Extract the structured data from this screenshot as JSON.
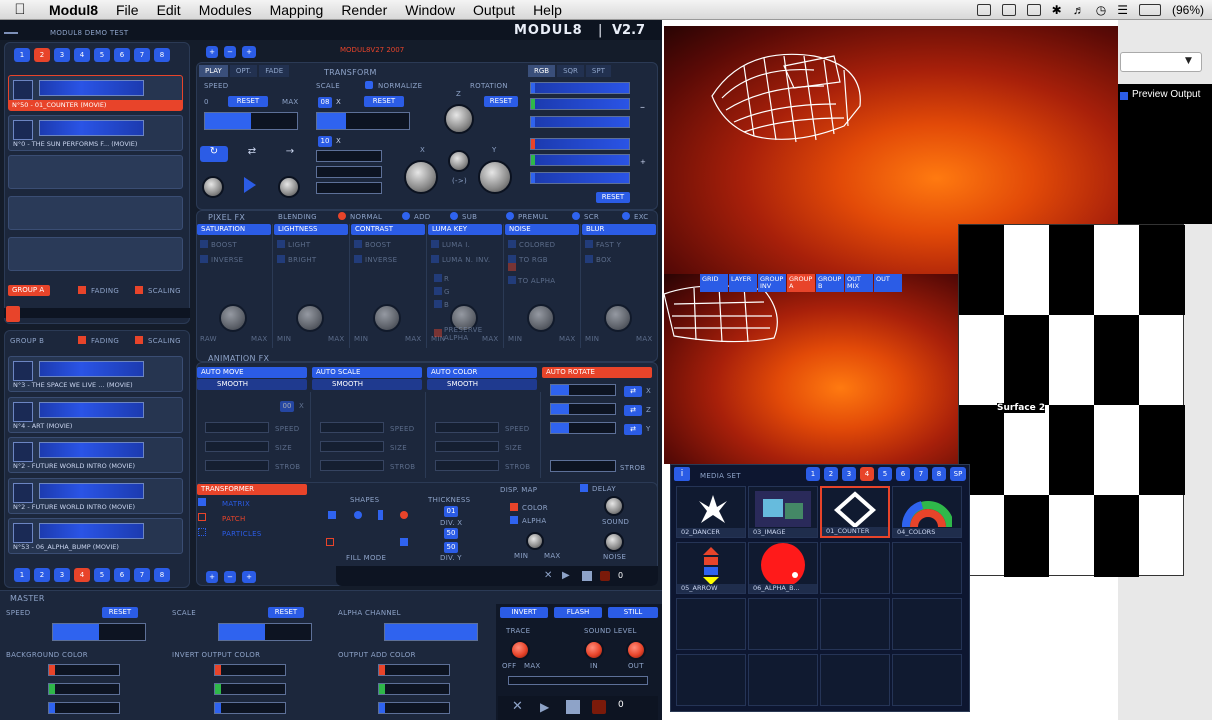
{
  "menubar": {
    "app": "Modul8",
    "items": [
      "File",
      "Edit",
      "Modules",
      "Mapping",
      "Render",
      "Window",
      "Output",
      "Help"
    ],
    "battery": "(96%)"
  },
  "app": {
    "project": "MODUL8 DEMO TEST",
    "logo": "MODUL8",
    "version": "V2.7",
    "copyright": "MODUL8V27 2007"
  },
  "group_a": {
    "numbers": [
      "1",
      "2",
      "3",
      "4",
      "5",
      "6",
      "7",
      "8"
    ],
    "active": "2",
    "slots": [
      "N°50 - 01_COUNTER (MOVIE)",
      "N°0 - THE SUN PERFORMS F... (MOVIE)"
    ],
    "label": "GROUP A",
    "fading": "FADING",
    "scaling": "SCALING"
  },
  "group_b": {
    "label": "GROUP B",
    "fading": "FADING",
    "scaling": "SCALING",
    "slots": [
      "N°3 - THE SPACE WE LIVE ... (MOVIE)",
      "N°4 - ART (MOVIE)",
      "N°2 - FUTURE WORLD INTRO (MOVIE)",
      "N°2 - FUTURE WORLD INTRO (MOVIE)",
      "N°53 - 06_ALPHA_BUMP (MOVIE)"
    ],
    "numbers": [
      "1",
      "2",
      "3",
      "4",
      "5",
      "6",
      "7",
      "8"
    ],
    "active": "4"
  },
  "layer_tabs": [
    "PLAY",
    "OPT.",
    "FADE"
  ],
  "transform": {
    "title": "TRANSFORM",
    "speed": "SPEED",
    "zero": "0",
    "reset": "RESET",
    "max": "MAX",
    "scale": "SCALE",
    "scale_val": "08",
    "x": "X",
    "normalize": "NORMALIZE",
    "rotation": "ROTATION",
    "z": "Z",
    "rot_x": "X",
    "rot_y": "Y",
    "arrow": "(->)",
    "ten": "10"
  },
  "rgb_tabs": [
    "RGB",
    "SQR",
    "SPT"
  ],
  "rgb_reset": "RESET",
  "pixel_fx": {
    "title": "PIXEL FX",
    "blending": "BLENDING",
    "normal": "NORMAL",
    "add": "ADD",
    "sub": "SUB",
    "premul": "PREMUL",
    "scr": "SCR",
    "exc": "EXC",
    "cols": [
      {
        "h": "SATURATION",
        "a": "BOOST",
        "b": "INVERSE",
        "mn": "RAW",
        "mx": "MAX"
      },
      {
        "h": "LIGHTNESS",
        "a": "LIGHT",
        "b": "BRIGHT",
        "mn": "MIN",
        "mx": "MAX"
      },
      {
        "h": "CONTRAST",
        "a": "BOOST",
        "b": "INVERSE",
        "mn": "MIN",
        "mx": "MAX"
      },
      {
        "h": "LUMA KEY",
        "a": "LUMA I.",
        "b": "LUMA N. INV.",
        "mn": "MIN",
        "mx": "MAX"
      },
      {
        "h": "NOISE",
        "a": "COLORED",
        "b": "TO RGB",
        "mn": "MIN",
        "mx": "MAX"
      },
      {
        "h": "BLUR",
        "a": "FAST Y",
        "b": "BOX",
        "mn": "MIN",
        "mx": "MAX"
      }
    ],
    "luma_extra": [
      "R",
      "G",
      "B"
    ],
    "preserve": "PRESERVE ALPHA",
    "noise_extra": "TO ALPHA"
  },
  "anim_fx": {
    "title": "ANIMATION FX",
    "cols": [
      {
        "h": "AUTO MOVE",
        "mode": "SMOOTH"
      },
      {
        "h": "AUTO SCALE",
        "mode": "SMOOTH"
      },
      {
        "h": "AUTO COLOR",
        "mode": "SMOOTH"
      },
      {
        "h": "AUTO ROTATE"
      }
    ],
    "speed": "SPEED",
    "size": "SIZE",
    "strob": "STROB",
    "x": "X",
    "y": "Y",
    "z": "Z",
    "zero": "00"
  },
  "transformer": {
    "title": "TRANSFORMER",
    "items": [
      "MATRIX",
      "PATCH",
      "PARTICLES"
    ],
    "shapes": "SHAPES",
    "thickness": "THICKNESS",
    "fill": "FILL MODE",
    "t1": "01",
    "t2": "50",
    "t3": "50",
    "divx": "DIV. X",
    "divy": "DIV. Y"
  },
  "disp": {
    "title": "DISP. MAP",
    "color": "COLOR",
    "alpha": "ALPHA",
    "min": "MIN",
    "max": "MAX",
    "delay": "DELAY",
    "sound": "SOUND",
    "noise": "NOISE"
  },
  "transport_zero": "0",
  "master": {
    "title": "MASTER",
    "speed": "SPEED",
    "scale": "SCALE",
    "alpha": "ALPHA CHANNEL",
    "reset": "RESET",
    "bg": "BACKGROUND COLOR",
    "inv": "INVERT OUTPUT COLOR",
    "add": "OUTPUT ADD COLOR",
    "invert": "INVERT",
    "flash": "FLASH",
    "still": "STILL",
    "trace": "TRACE",
    "sound": "SOUND LEVEL",
    "off": "OFF",
    "max": "MAX",
    "in": "IN",
    "out": "OUT",
    "zero": "0"
  },
  "preview": {
    "tabs": [
      "GRID",
      "LAYER",
      "GROUP INV",
      "GROUP A",
      "GROUP B",
      "OUT MIX",
      "OUT"
    ],
    "surface": "Surface 2",
    "preview_output": "Preview Output"
  },
  "media": {
    "title": "MEDIA SET",
    "numbers": [
      "1",
      "2",
      "3",
      "4",
      "5",
      "6",
      "7",
      "8",
      "SP"
    ],
    "active": "4",
    "items": [
      "02_DANCER",
      "03_IMAGE",
      "01_COUNTER",
      "04_COLORS",
      "05_ARROW",
      "06_ALPHA_B..."
    ]
  },
  "colors": {
    "accent": "#2b5ce6",
    "selected": "#e8442a",
    "panel": "#1c273c"
  }
}
